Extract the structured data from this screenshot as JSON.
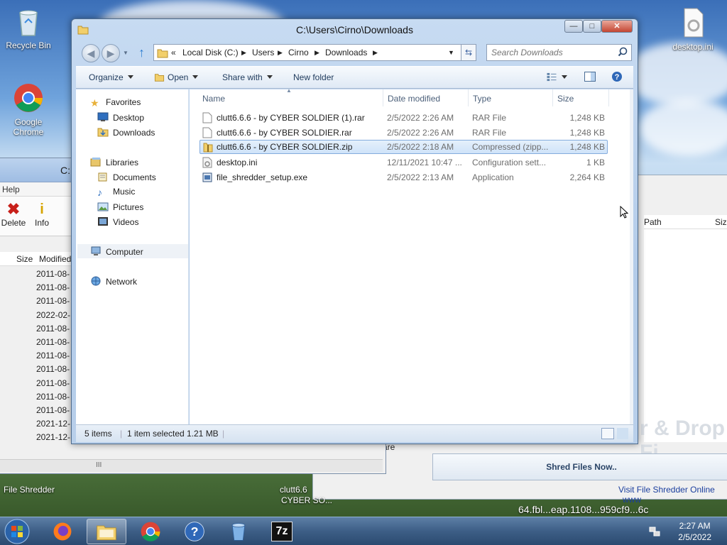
{
  "desktop": {
    "icons": [
      {
        "label": "Recycle Bin"
      },
      {
        "label": "Google Chrome"
      },
      {
        "label": "desktop.ini"
      }
    ],
    "bottom_labels": {
      "file_shredder": "File Shredder",
      "clutt_label_1": "clutt6.6",
      "clutt_label_2": "CYBER SO..."
    },
    "url_fragment": "64.fbl...eap.1108...959cf9...6c"
  },
  "background_window": {
    "title_fragment": "C:",
    "menu": "Help",
    "tools": [
      {
        "label": "Delete"
      },
      {
        "label": "Info"
      }
    ],
    "columns": [
      "Size",
      "Modified"
    ],
    "dates": [
      "2011-08-",
      "2011-08-",
      "2011-08-",
      "2022-02-",
      "2011-08-",
      "2011-08-",
      "2011-08-",
      "2011-08-",
      "2011-08-",
      "2011-08-",
      "2011-08-",
      "2021-12-",
      "2021-12-"
    ],
    "scroll_label": "III",
    "right_columns": [
      "Path",
      "Size"
    ],
    "shred_button": "Shred Files Now..",
    "visit_link": "Visit File Shredder Online",
    "visit_link_2": "www",
    "drop_text": "r & Drop Fi",
    "share_fragment": "are"
  },
  "explorer": {
    "title": "C:\\Users\\Cirno\\Downloads",
    "window_controls": {
      "minimize": "—",
      "maximize": "□",
      "close": "✕"
    },
    "breadcrumbs": [
      "Local Disk (C:)",
      "Users",
      "Cirno",
      "Downloads"
    ],
    "breadcrumb_overflow": "«",
    "search": {
      "placeholder": "Search Downloads"
    },
    "toolbar": {
      "organize": "Organize",
      "open": "Open",
      "share_with": "Share with",
      "new_folder": "New folder"
    },
    "nav": {
      "favorites": "Favorites",
      "desktop": "Desktop",
      "downloads": "Downloads",
      "libraries": "Libraries",
      "documents": "Documents",
      "music": "Music",
      "pictures": "Pictures",
      "videos": "Videos",
      "computer": "Computer",
      "network": "Network"
    },
    "columns": {
      "name": "Name",
      "date_modified": "Date modified",
      "type": "Type",
      "size": "Size"
    },
    "files": [
      {
        "name": "clutt6.6.6 - by CYBER SOLDIER (1).rar",
        "date": "2/5/2022 2:26 AM",
        "type": "RAR File",
        "size": "1,248 KB",
        "icon": "rar-file-icon"
      },
      {
        "name": "clutt6.6.6 - by CYBER SOLDIER.rar",
        "date": "2/5/2022 2:26 AM",
        "type": "RAR File",
        "size": "1,248 KB",
        "icon": "rar-file-icon"
      },
      {
        "name": "clutt6.6.6 - by CYBER SOLDIER.zip",
        "date": "2/5/2022 2:18 AM",
        "type": "Compressed (zipp...",
        "size": "1,248 KB",
        "icon": "zip-folder-icon",
        "selected": true
      },
      {
        "name": "desktop.ini",
        "date": "12/11/2021 10:47 ...",
        "type": "Configuration sett...",
        "size": "1 KB",
        "icon": "settings-file-icon"
      },
      {
        "name": "file_shredder_setup.exe",
        "date": "2/5/2022 2:13 AM",
        "type": "Application",
        "size": "2,264 KB",
        "icon": "installer-icon"
      }
    ],
    "status": {
      "item_count": "5 items",
      "selection": "1 item selected",
      "selection_size": "1.21 MB"
    }
  },
  "taskbar": {
    "clock_time": "2:27 AM",
    "clock_date": "2/5/2022",
    "apps": [
      "start-orb",
      "firefox",
      "explorer",
      "chrome",
      "help",
      "recycle",
      "7zip"
    ],
    "seven_zip_label": "7z"
  },
  "colors": {
    "selection_bg": "#cfe3f9",
    "selection_border": "#84acdd",
    "taskbar": "#3d5e86",
    "link": "#1a3e9e"
  }
}
